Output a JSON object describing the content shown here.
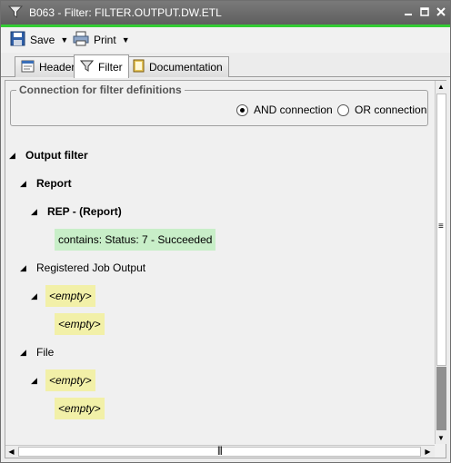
{
  "window": {
    "title": "B063 - Filter: FILTER.OUTPUT.DW.ETL",
    "app_icon": "filter-funnel-icon",
    "controls": [
      "minimize",
      "maximize",
      "close"
    ]
  },
  "toolbar": {
    "save_label": "Save",
    "print_label": "Print"
  },
  "tabs": [
    {
      "label": "Header",
      "icon": "header-doc-icon",
      "active": false
    },
    {
      "label": "Filter",
      "icon": "filter-funnel-icon",
      "active": true
    },
    {
      "label": "Documentation",
      "icon": "book-icon",
      "active": false
    }
  ],
  "connection": {
    "legend": "Connection for filter definitions",
    "options": [
      {
        "label": "AND connection",
        "selected": true
      },
      {
        "label": "OR connection",
        "selected": false
      }
    ]
  },
  "tree": {
    "output_filter": "Output filter",
    "report": "Report",
    "rep_report": "REP - (Report)",
    "rep_condition": "contains: Status: 7 - Succeeded",
    "registered_job_output": "Registered Job Output",
    "rjo_empty_1": "<empty>",
    "rjo_empty_2": "<empty>",
    "file": "File",
    "file_empty_1": "<empty>",
    "file_empty_2": "<empty>"
  },
  "colors": {
    "accent_line": "#33cc33",
    "condition_green": "#c8eec8",
    "empty_yellow": "#f2f0a8"
  }
}
